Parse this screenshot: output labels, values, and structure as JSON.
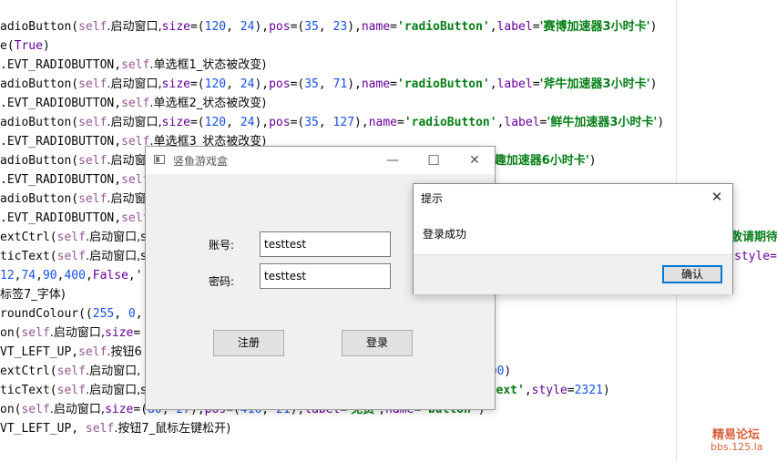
{
  "editor": {
    "lines": [
      [
        [
          "t",
          "adioButton("
        ],
        [
          "s",
          "self"
        ],
        [
          "t",
          ".启动窗口,"
        ],
        [
          "k",
          "size"
        ],
        [
          "t",
          "=("
        ],
        [
          "n",
          "120"
        ],
        [
          "t",
          ", "
        ],
        [
          "n",
          "24"
        ],
        [
          "t",
          "),"
        ],
        [
          "k",
          "pos"
        ],
        [
          "t",
          "=("
        ],
        [
          "n",
          "35"
        ],
        [
          "t",
          ", "
        ],
        [
          "n",
          "23"
        ],
        [
          "t",
          "),"
        ],
        [
          "k",
          "name"
        ],
        [
          "t",
          "="
        ],
        [
          "q",
          "'radioButton'"
        ],
        [
          "t",
          ","
        ],
        [
          "k",
          "label"
        ],
        [
          "t",
          "="
        ],
        [
          "q",
          "'赛博加速器3小时卡'"
        ],
        [
          "t",
          ")"
        ]
      ],
      [
        [
          "t",
          "e("
        ],
        [
          "k",
          "True"
        ],
        [
          "t",
          ")"
        ]
      ],
      [
        [
          "t",
          ".EVT_RADIOBUTTON,"
        ],
        [
          "s",
          "self"
        ],
        [
          "t",
          ".单选框1_状态被改变)"
        ]
      ],
      [
        [
          "t",
          "adioButton("
        ],
        [
          "s",
          "self"
        ],
        [
          "t",
          ".启动窗口,"
        ],
        [
          "k",
          "size"
        ],
        [
          "t",
          "=("
        ],
        [
          "n",
          "120"
        ],
        [
          "t",
          ", "
        ],
        [
          "n",
          "24"
        ],
        [
          "t",
          "),"
        ],
        [
          "k",
          "pos"
        ],
        [
          "t",
          "=("
        ],
        [
          "n",
          "35"
        ],
        [
          "t",
          ", "
        ],
        [
          "n",
          "71"
        ],
        [
          "t",
          "),"
        ],
        [
          "k",
          "name"
        ],
        [
          "t",
          "="
        ],
        [
          "q",
          "'radioButton'"
        ],
        [
          "t",
          ","
        ],
        [
          "k",
          "label"
        ],
        [
          "t",
          "="
        ],
        [
          "q",
          "'斧牛加速器3小时卡'"
        ],
        [
          "t",
          ")"
        ]
      ],
      [
        [
          "t",
          ".EVT_RADIOBUTTON,"
        ],
        [
          "s",
          "self"
        ],
        [
          "t",
          ".单选框2_状态被改变)"
        ]
      ],
      [
        [
          "t",
          "adioButton("
        ],
        [
          "s",
          "self"
        ],
        [
          "t",
          ".启动窗口,"
        ],
        [
          "k",
          "size"
        ],
        [
          "t",
          "=("
        ],
        [
          "n",
          "120"
        ],
        [
          "t",
          ", "
        ],
        [
          "n",
          "24"
        ],
        [
          "t",
          "),"
        ],
        [
          "k",
          "pos"
        ],
        [
          "t",
          "=("
        ],
        [
          "n",
          "35"
        ],
        [
          "t",
          ", "
        ],
        [
          "n",
          "127"
        ],
        [
          "t",
          "),"
        ],
        [
          "k",
          "name"
        ],
        [
          "t",
          "="
        ],
        [
          "q",
          "'radioButton'"
        ],
        [
          "t",
          ","
        ],
        [
          "k",
          "label"
        ],
        [
          "t",
          "="
        ],
        [
          "q",
          "'鲜牛加速器3小时卡'"
        ],
        [
          "t",
          ")"
        ]
      ],
      [
        [
          "t",
          ".EVT_RADIOBUTTON,"
        ],
        [
          "s",
          "self"
        ],
        [
          "t",
          ".单选框3_状态被改变)"
        ]
      ],
      [
        [
          "t",
          "adioButton("
        ],
        [
          "s",
          "self"
        ],
        [
          "t",
          ".启动窗口"
        ],
        [
          "t",
          "                                      "
        ],
        [
          "t",
          ","
        ],
        [
          "k",
          "label"
        ],
        [
          "t",
          "="
        ],
        [
          "q",
          "'有趣加速器6小时卡'"
        ],
        [
          "t",
          ")"
        ]
      ],
      [
        [
          "t",
          ".EVT_RADIOBUTTON,"
        ],
        [
          "s",
          "self"
        ]
      ],
      [
        [
          "t",
          "adioButton("
        ],
        [
          "s",
          "self"
        ],
        [
          "t",
          ".启动窗口"
        ]
      ],
      [
        [
          "t",
          ".EVT_RADIOBUTTON,"
        ],
        [
          "s",
          "self"
        ]
      ],
      [
        [
          "t",
          "extCtrl("
        ],
        [
          "s",
          "self"
        ],
        [
          "t",
          ".启动窗口,s"
        ]
      ],
      [
        [
          "t",
          "ticText("
        ],
        [
          "s",
          "self"
        ],
        [
          "t",
          ".启动窗口,s"
        ]
      ],
      [
        [
          "n",
          "12"
        ],
        [
          "t",
          ","
        ],
        [
          "n",
          "74"
        ],
        [
          "t",
          ","
        ],
        [
          "n",
          "90"
        ],
        [
          "t",
          ","
        ],
        [
          "n",
          "400"
        ],
        [
          "t",
          ","
        ],
        [
          "k",
          "False"
        ],
        [
          "t",
          ",'"
        ]
      ],
      [
        [
          "t",
          "标签7_字体)"
        ]
      ],
      [
        [
          "t",
          "roundColour(("
        ],
        [
          "n",
          "255"
        ],
        [
          "t",
          ", "
        ],
        [
          "n",
          "0"
        ],
        [
          "t",
          ","
        ]
      ],
      [
        [
          "t",
          "on("
        ],
        [
          "s",
          "self"
        ],
        [
          "t",
          ".启动窗口,"
        ],
        [
          "k",
          "size"
        ],
        [
          "t",
          "="
        ],
        [
          "t",
          "                                          "
        ],
        [
          "q",
          "n'"
        ],
        [
          "t",
          ")"
        ]
      ],
      [
        [
          "t",
          "VT_LEFT_UP,"
        ],
        [
          "s",
          "self"
        ],
        [
          "t",
          ".按钮6"
        ]
      ],
      [
        [
          "t",
          "extCtrl("
        ],
        [
          "s",
          "self"
        ],
        [
          "t",
          ".启动窗口,"
        ],
        [
          "t",
          "                                          "
        ],
        [
          "q",
          "'"
        ],
        [
          "t",
          ","
        ],
        [
          "k",
          "style"
        ],
        [
          "t",
          "="
        ],
        [
          "n",
          "0"
        ],
        [
          "t",
          ")"
        ]
      ],
      [
        [
          "t",
          "ticText("
        ],
        [
          "s",
          "self"
        ],
        [
          "t",
          ".启动窗口,s"
        ],
        [
          "t",
          "                                         "
        ],
        [
          "q",
          "'staticText'"
        ],
        [
          "t",
          ","
        ],
        [
          "k",
          "style"
        ],
        [
          "t",
          "="
        ],
        [
          "n",
          "2321"
        ],
        [
          "t",
          ")"
        ]
      ],
      [
        [
          "t",
          "on("
        ],
        [
          "s",
          "self"
        ],
        [
          "t",
          ".启动窗口,"
        ],
        [
          "k",
          "size"
        ],
        [
          "t",
          "=("
        ],
        [
          "n",
          "80"
        ],
        [
          "t",
          ", "
        ],
        [
          "n",
          "27"
        ],
        [
          "t",
          "),"
        ],
        [
          "k",
          "pos"
        ],
        [
          "t",
          "=("
        ],
        [
          "n",
          "416"
        ],
        [
          "t",
          ", "
        ],
        [
          "n",
          "21"
        ],
        [
          "t",
          "),"
        ],
        [
          "k",
          "label"
        ],
        [
          "t",
          "="
        ],
        [
          "q",
          "'免费'"
        ],
        [
          "t",
          ","
        ],
        [
          "k",
          "name"
        ],
        [
          "t",
          "="
        ],
        [
          "q",
          "'button'"
        ],
        [
          "t",
          ")"
        ]
      ],
      [
        [
          "t",
          "VT_LEFT_UP, "
        ],
        [
          "s",
          "self"
        ],
        [
          "t",
          ".按钮7_鼠标左键松开)"
        ]
      ]
    ],
    "overflow_text_1": "敬请期待",
    "overflow_text_2": "style="
  },
  "watermark": {
    "line1": "精易论坛",
    "line2": "bbs.125.la"
  },
  "app_window": {
    "title": "竖鱼游戏盒",
    "minimize_glyph": "—",
    "maximize_glyph": "☐",
    "close_glyph": "✕",
    "account_label": "账号:",
    "account_value": "testtest",
    "password_label": "密码:",
    "password_value": "testtest",
    "register_button": "注册",
    "login_button": "登录"
  },
  "dialog": {
    "title": "提示",
    "close_glyph": "✕",
    "message": "登录成功",
    "ok_button": "确认"
  }
}
